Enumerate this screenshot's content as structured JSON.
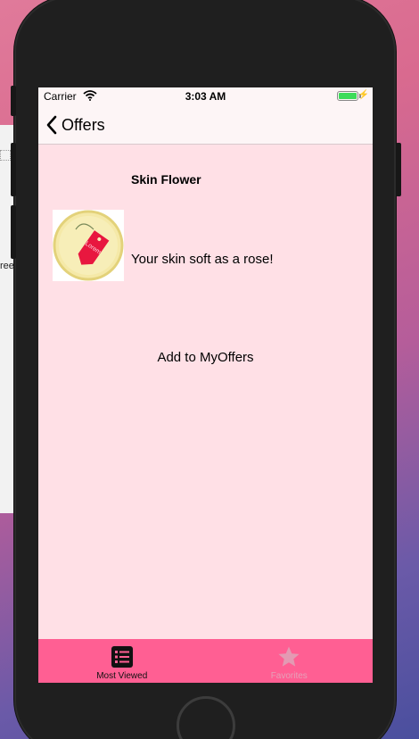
{
  "background": {
    "window_fragment_text": "ree"
  },
  "status_bar": {
    "carrier": "Carrier",
    "time": "3:03 AM"
  },
  "nav": {
    "back_label": "Offers"
  },
  "offer": {
    "title": "Skin Flower",
    "description": "Your skin soft as a rose!",
    "image_icon": "price-tag-icon",
    "tag_text": "Lorem"
  },
  "actions": {
    "add_label": "Add to MyOffers"
  },
  "tab_bar": {
    "tabs": [
      {
        "label": "Most Viewed",
        "icon": "list-icon",
        "selected": true
      },
      {
        "label": "Favorites",
        "icon": "star-icon",
        "selected": false
      }
    ]
  },
  "colors": {
    "screen_bg": "#ffe0e6",
    "tab_bar_bg": "#ff5f93",
    "bar_bg": "#fdf5f6",
    "tag_red": "#e8173f",
    "tag_circle": "#f5e9a8"
  }
}
